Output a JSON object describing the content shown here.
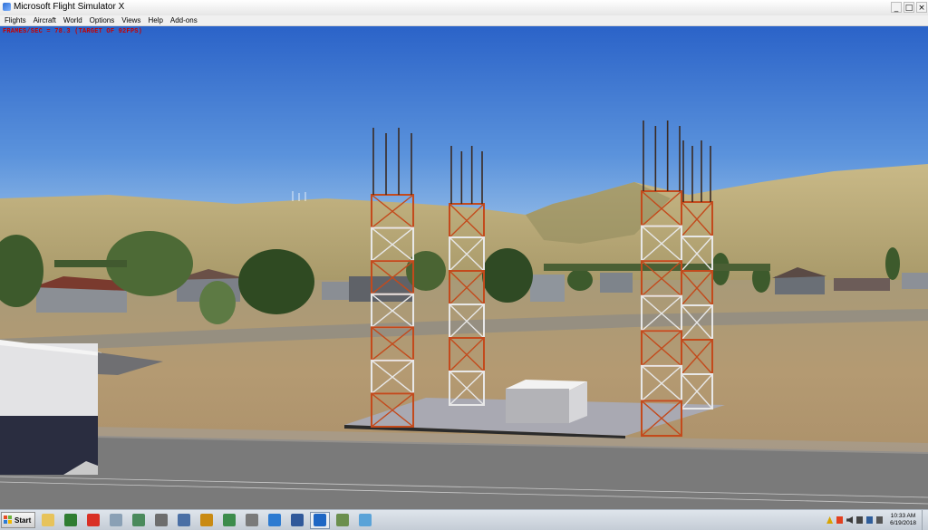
{
  "window": {
    "title": "Microsoft Flight Simulator X",
    "minimize_glyph": "_",
    "maximize_glyph": "□",
    "close_glyph": "×"
  },
  "menu": [
    {
      "label": "Flights"
    },
    {
      "label": "Aircraft"
    },
    {
      "label": "World"
    },
    {
      "label": "Options"
    },
    {
      "label": "Views"
    },
    {
      "label": "Help"
    },
    {
      "label": "Add-ons"
    }
  ],
  "overlay": {
    "fps_text": "FRAMES/SEC = 78.3   (TARGET OF 92FPS)"
  },
  "scene": {
    "sky_top": "#2b63c8",
    "sky_bottom": "#9cc3ea",
    "hills": "#b8a878",
    "ground": "#b59a72",
    "tower_red": "#c34a1c",
    "tower_white": "#e8e8e8"
  },
  "taskbar": {
    "start_label": "Start",
    "apps": [
      {
        "icon": "file-explorer-icon",
        "color": "#e7c35b"
      },
      {
        "icon": "green-app-icon",
        "color": "#2f7d32"
      },
      {
        "icon": "chrome-icon",
        "color": "#d93025"
      },
      {
        "icon": "tools-icon",
        "color": "#8aa0b5"
      },
      {
        "icon": "aircraft-green-icon",
        "color": "#4a8a5c"
      },
      {
        "icon": "aircraft-gray-icon",
        "color": "#6d6d6d"
      },
      {
        "icon": "hangar-icon",
        "color": "#4a6fa5"
      },
      {
        "icon": "dx-icon",
        "color": "#c98a12"
      },
      {
        "icon": "window-app-icon",
        "color": "#3c8c4c"
      },
      {
        "icon": "jet-icon",
        "color": "#7a7a7a"
      },
      {
        "icon": "globe-icon",
        "color": "#2e7bd1"
      },
      {
        "icon": "monitor-icon",
        "color": "#31599a"
      },
      {
        "icon": "fsx-icon",
        "color": "#1f67c4",
        "active": true
      },
      {
        "icon": "map-icon",
        "color": "#6b8f4e"
      },
      {
        "icon": "blue-app-icon",
        "color": "#5aa3d8"
      }
    ],
    "tray": {
      "time": "10:33 AM",
      "date": "6/19/2018"
    }
  }
}
